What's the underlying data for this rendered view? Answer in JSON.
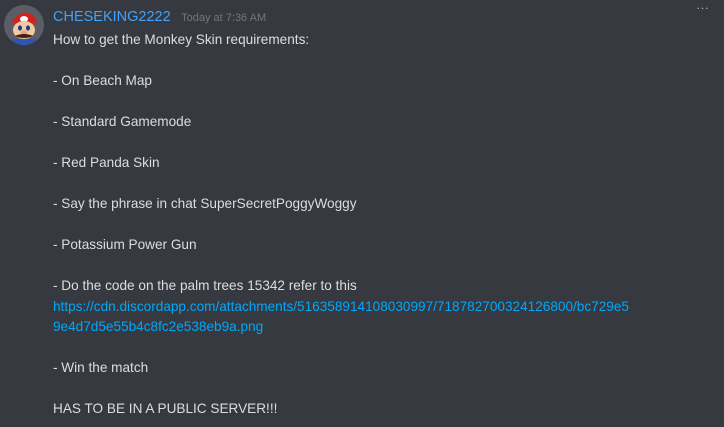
{
  "message": {
    "author": "CHESEKING2222",
    "timestamp": "Today at 7:36 AM",
    "avatar_icon": "mario-avatar",
    "more_icon": "...",
    "lines": {
      "l1": "How to get the Monkey Skin requirements:",
      "l2": "- On Beach Map",
      "l3": "- Standard Gamemode",
      "l4": "- Red Panda Skin",
      "l5": "- Say the phrase in chat SuperSecretPoggyWoggy",
      "l6": "- Potassium Power Gun",
      "l7": "- Do the code on the palm trees 15342 refer to this",
      "link1": "https://cdn.discordapp.com/attachments/516358914108030997/718782700324126800/bc729e5",
      "link2": "9e4d7d5e55b4c8fc2e538eb9a.png",
      "l8": "- Win the match",
      "l9": "HAS TO BE IN A PUBLIC SERVER!!!"
    }
  },
  "colors": {
    "background": "#36393f",
    "username": "#3ea3ff",
    "text": "#dcddde",
    "link": "#00a8fc",
    "timestamp": "#72767d"
  }
}
